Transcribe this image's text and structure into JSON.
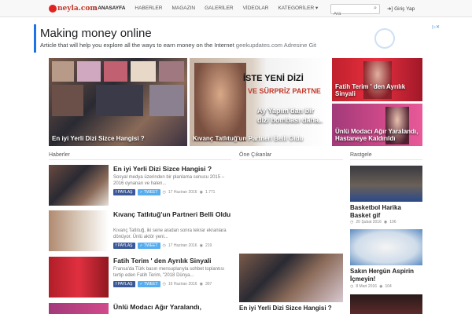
{
  "brand": {
    "logo_text": "neyla.com"
  },
  "nav": {
    "items": [
      "ANASAYFA",
      "HABERLER",
      "MAGAZIN",
      "GALERİLER",
      "VİDEOLAR",
      "KATEGORİLER ▾"
    ],
    "search_placeholder": "Ara",
    "login": "Giriş Yap"
  },
  "ad": {
    "title": "Making money online",
    "desc": "Article that will help you explore all the ways to earn money on the Internet",
    "domain": "geekupdates.com Adresine Git"
  },
  "featured": [
    {
      "caption": "En iyi Yerli Dizi Sizce Hangisi ?"
    },
    {
      "caption": "Kıvanç Tatlıtuğ'un Partneri Belli Oldu",
      "overlay_line1": "İSTE YENİ DİZİ",
      "overlay_line2": "VE SÜRPRİZ PARTNE",
      "overlay_line3": "Ay Yapım'dan bir",
      "overlay_line4": "dizi bombası daha.."
    },
    {
      "caption": "Fatih Terim ' den Ayrılık Sinyali"
    },
    {
      "caption": "Ünlü Modacı Ağır Yaralandı, Hastaneye Kaldırıldı"
    }
  ],
  "sections": {
    "news": "Haberler",
    "highlights": "Öne Çıkanlar",
    "random": "Rastgele"
  },
  "news": [
    {
      "title": "En iyi Yerli Dizi Sizce Hangisi ?",
      "desc": "Sosyal medya üzerinden bir planlama sonucu 2015 – 2016 oynanan ve halen...",
      "date": "17 Haziran 2016",
      "views": "1.771"
    },
    {
      "title": "Kıvanç Tatlıtuğ'un Partneri Belli Oldu",
      "desc": "Kıvanç Tatlıtuğ, iki sene aradan sonra tekrar ekranlara dönüyor. Ünlü aktör yeni...",
      "date": "17 Haziran 2016",
      "views": "219"
    },
    {
      "title": "Fatih Terim ' den Ayrılık Sinyali",
      "desc": "Fransa'da Türk basın mensuplarıyla sohbet toplantısı tertip eden Fatih Terim, \"2018 Dünya...",
      "date": "16 Haziran 2016",
      "views": "307"
    },
    {
      "title": "Ünlü Modacı Ağır Yaralandı,"
    }
  ],
  "share": {
    "fb": "PAYLAŞ",
    "tw": "TWEET"
  },
  "highlight": {
    "title": "En iyi Yerli Dizi Sizce Hangisi ?"
  },
  "random": [
    {
      "title": "Basketbol Harika Basket gif",
      "date": "20 Şubat 2016",
      "views": "106"
    },
    {
      "title": "Sakın Hergün Aspirin İçmeyin!",
      "date": "8 Mart 2016",
      "views": "104"
    }
  ]
}
